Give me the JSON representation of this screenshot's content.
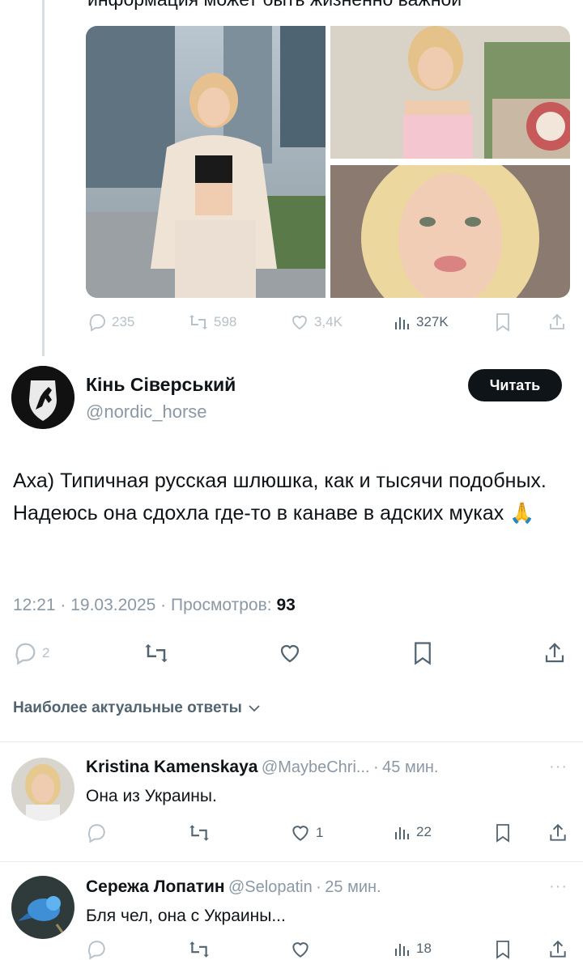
{
  "thread": {
    "truncated_text": "информация может быть жизненно важной"
  },
  "parent_tweet": {
    "actions": {
      "replies": "235",
      "retweets": "598",
      "likes": "3,4K",
      "views": "327K"
    }
  },
  "tweet": {
    "author_name": "Кінь Сіверський",
    "author_handle": "@nordic_horse",
    "follow_label": "Читать",
    "text": "Аха) Типичная русская шлюшка, как и тысячи подобных. Надеюсь она сдохла где-то в канаве в адских муках 🙏",
    "time": "12:21",
    "date": "19.03.2025",
    "views_label": "Просмотров:",
    "views_count": "93",
    "replies_count": "2"
  },
  "replies_section": {
    "title": "Наиболее актуальные ответы"
  },
  "replies": [
    {
      "name": "Kristina Kamenskaya",
      "handle": "@MaybeChri...",
      "time": "45 мин.",
      "text": "Она из Украины.",
      "likes": "1",
      "views": "22"
    },
    {
      "name": "Сережа Лопатин",
      "handle": "@Selopatin",
      "time": "25 мин.",
      "text": "Бля чел, она с Украины...",
      "views": "18"
    }
  ],
  "icons": [
    "reply-icon",
    "retweet-icon",
    "like-icon",
    "views-icon",
    "bookmark-icon",
    "share-icon",
    "more-icon",
    "chevron-down-icon",
    "pray-emoji"
  ],
  "colors": {
    "text": "#0f1419",
    "muted": "#8b98a5",
    "action_faded": "#b7c1ca",
    "button_bg": "#0f1419",
    "divider": "#e6ecf0"
  }
}
